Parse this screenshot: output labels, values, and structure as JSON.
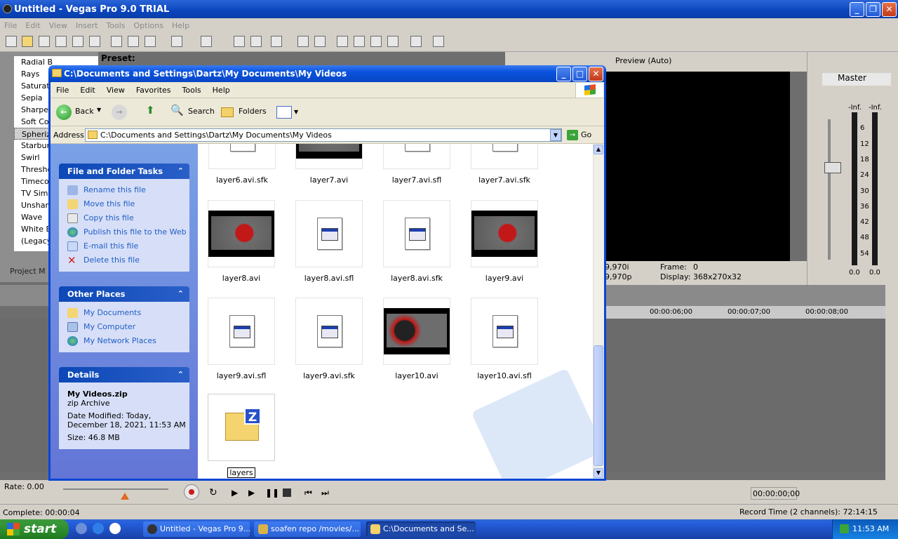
{
  "vegas": {
    "title": "Untitled - Vegas Pro 9.0 TRIAL",
    "menu": [
      "File",
      "Edit",
      "View",
      "Insert",
      "Tools",
      "Options",
      "Help"
    ],
    "preset_label": "Preset:",
    "fx_items": [
      "Radial B",
      "Rays",
      "Saturat",
      "Sepia",
      "Sharpen",
      "Soft Co",
      "Spheriz",
      "Starbur",
      "Swirl",
      "Thresho",
      "Timecod",
      "TV Simu",
      "Unsharp",
      "Wave",
      "White B",
      "(Legacy"
    ],
    "fx_selected_index": 6,
    "project_tab": "Project M",
    "preview_label": "Preview (Auto)",
    "preview_info": {
      "fps1": "9,970i",
      "fps2": "9,970p",
      "frame_label": "Frame:",
      "frame_value": "0",
      "display_label": "Display:",
      "display_value": "368x270x32"
    },
    "master_label": "Master",
    "meter_left_top": "-Inf.",
    "meter_right_top": "-Inf.",
    "meter_scale": [
      "6",
      "12",
      "18",
      "24",
      "30",
      "36",
      "42",
      "48",
      "54"
    ],
    "meter_left_bottom": "0.0",
    "meter_right_bottom": "0.0",
    "ruler": [
      "00:00:06;00",
      "00:00:07;00",
      "00:00:08;00"
    ],
    "rate": "Rate: 0.00",
    "timecode": "00:00:00;00",
    "complete": "Complete: 00:00:04",
    "record_time": "Record Time (2 channels): 72:14:15"
  },
  "explorer": {
    "title": "C:\\Documents and Settings\\Dartz\\My Documents\\My Videos",
    "menu": [
      "File",
      "Edit",
      "View",
      "Favorites",
      "Tools",
      "Help"
    ],
    "toolbar": {
      "back": "Back",
      "search": "Search",
      "folders": "Folders"
    },
    "address_label": "Address",
    "address_value": "C:\\Documents and Settings\\Dartz\\My Documents\\My Videos",
    "go_label": "Go",
    "file_tasks": {
      "header": "File and Folder Tasks",
      "items": [
        "Rename this file",
        "Move this file",
        "Copy this file",
        "Publish this file to the Web",
        "E-mail this file",
        "Delete this file"
      ]
    },
    "other_places": {
      "header": "Other Places",
      "items": [
        "My Documents",
        "My Computer",
        "My Network Places"
      ]
    },
    "details": {
      "header": "Details",
      "name": "My Videos.zip",
      "type": "zip Archive",
      "modified_1": "Date Modified: Today,",
      "modified_2": "December 18, 2021, 11:53 AM",
      "size": "Size: 46.8 MB"
    },
    "files_row0": [
      "layer6.avi.sfk",
      "layer7.avi",
      "layer7.avi.sfl",
      "layer7.avi.sfk"
    ],
    "files": [
      "layer8.avi",
      "layer8.avi.sfl",
      "layer8.avi.sfk",
      "layer9.avi",
      "layer9.avi.sfl",
      "layer9.avi.sfk",
      "layer10.avi",
      "layer10.avi.sfl"
    ],
    "rename_value": "layers"
  },
  "taskbar": {
    "start": "start",
    "tasks": [
      "Untitled - Vegas Pro 9...",
      "soafen repo /movies/...",
      "C:\\Documents and Se..."
    ],
    "clock": "11:53 AM"
  }
}
